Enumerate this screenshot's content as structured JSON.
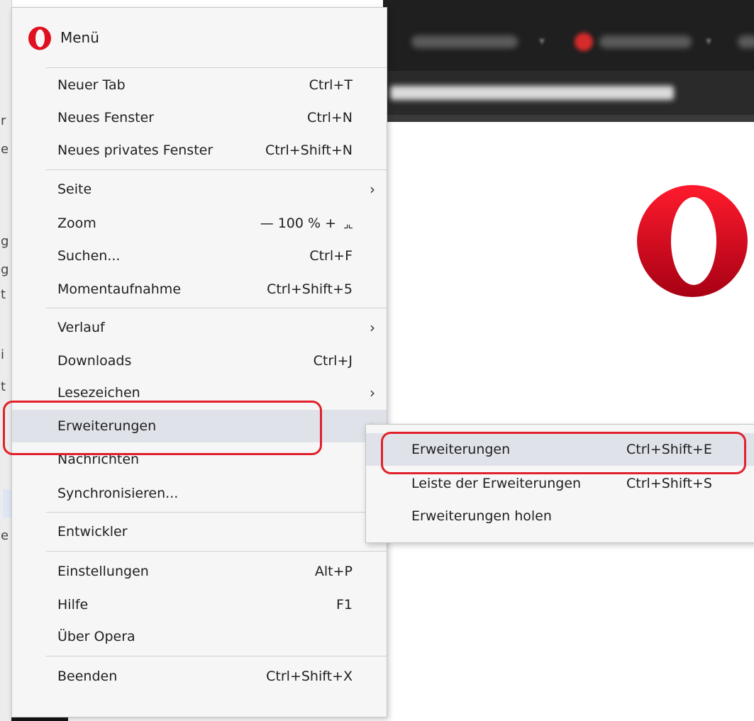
{
  "menu": {
    "title": "Menü",
    "groups": [
      [
        {
          "label": "Neuer Tab",
          "shortcut": "Ctrl+T"
        },
        {
          "label": "Neues Fenster",
          "shortcut": "Ctrl+N"
        },
        {
          "label": "Neues privates Fenster",
          "shortcut": "Ctrl+Shift+N"
        }
      ],
      [
        {
          "label": "Seite",
          "submenu": true
        },
        {
          "label": "Zoom",
          "zoom": {
            "minus": "—",
            "value": "100 %",
            "plus": "+",
            "fullscreen_icon": "fullscreen-exit-icon"
          }
        },
        {
          "label": "Suchen...",
          "shortcut": "Ctrl+F"
        },
        {
          "label": "Momentaufnahme",
          "shortcut": "Ctrl+Shift+5"
        }
      ],
      [
        {
          "label": "Verlauf",
          "submenu": true
        },
        {
          "label": "Downloads",
          "shortcut": "Ctrl+J"
        },
        {
          "label": "Lesezeichen",
          "submenu": true
        },
        {
          "label": "Erweiterungen",
          "submenu": true,
          "highlighted": true
        },
        {
          "label": "Nachrichten"
        },
        {
          "label": "Synchronisieren..."
        }
      ],
      [
        {
          "label": "Entwickler"
        }
      ],
      [
        {
          "label": "Einstellungen",
          "shortcut": "Alt+P"
        },
        {
          "label": "Hilfe",
          "shortcut": "F1"
        },
        {
          "label": "Über Opera"
        }
      ],
      [
        {
          "label": "Beenden",
          "shortcut": "Ctrl+Shift+X"
        }
      ]
    ]
  },
  "submenu": {
    "items": [
      {
        "label": "Erweiterungen",
        "shortcut": "Ctrl+Shift+E",
        "highlighted": true
      },
      {
        "label": "Leiste der Erweiterungen",
        "shortcut": "Ctrl+Shift+S"
      },
      {
        "label": "Erweiterungen holen"
      }
    ]
  },
  "icons": {
    "menu_logo": "opera-logo-icon",
    "page_logo": "opera-logo-icon",
    "submenu_arrow": "chevron-right-icon"
  },
  "colors": {
    "menu_bg": "#f6f6f6",
    "highlight": "#dfe2e9",
    "annotation_ring": "#e2202b",
    "opera_red": "#d9262b"
  }
}
